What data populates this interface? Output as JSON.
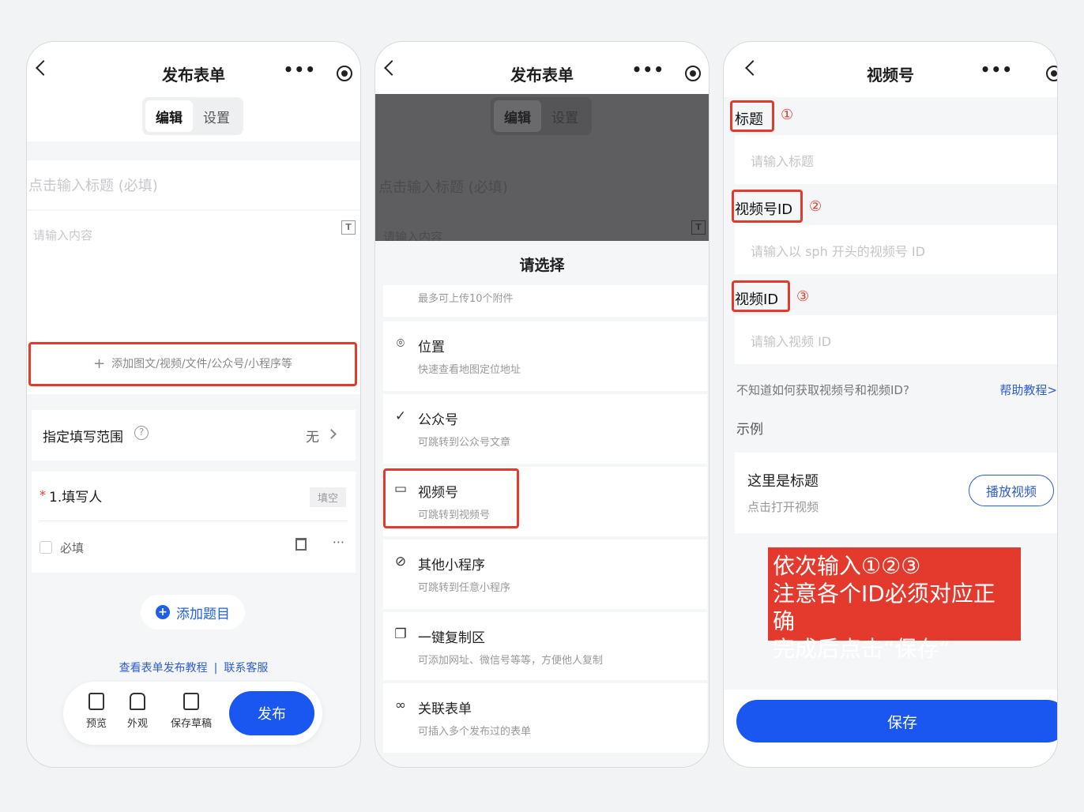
{
  "phone1": {
    "nav_title": "发布表单",
    "tabs": [
      "编辑",
      "设置"
    ],
    "title_placeholder": "点击输入标题 (必填)",
    "content_placeholder": "请输入内容",
    "t_icon": "T",
    "add_attachment": "添加图文/视频/文件/公众号/小程序等",
    "scope_label": "指定填写范围",
    "scope_value": "无",
    "question_label": "1.填写人",
    "required_star": "*",
    "question_tag": "填空",
    "required_label": "必填",
    "more_dots": "···",
    "add_question": "添加题目",
    "tutorial_link": "查看表单发布教程",
    "separator": "|",
    "support_link": "联系客服",
    "toolbar": {
      "preview": "预览",
      "appearance": "外观",
      "save_draft": "保存草稿",
      "publish": "发布"
    }
  },
  "phone2": {
    "nav_title": "发布表单",
    "tabs": [
      "编辑",
      "设置"
    ],
    "title_placeholder": "点击输入标题 (必填)",
    "content_placeholder": "请输入内容",
    "sheet_title": "请选择",
    "attachment_hint": "最多可上传10个附件",
    "options": [
      {
        "name": "位置",
        "desc": "快速查看地图定位地址",
        "icon": "location-icon"
      },
      {
        "name": "公众号",
        "desc": "可跳转到公众号文章",
        "icon": "official-account-icon"
      },
      {
        "name": "视频号",
        "desc": "可跳转到视频号",
        "icon": "video-icon"
      },
      {
        "name": "其他小程序",
        "desc": "可跳转到任意小程序",
        "icon": "mini-program-icon"
      },
      {
        "name": "一键复制区",
        "desc": "可添加网址、微信号等等，方便他人复制",
        "icon": "copy-icon"
      },
      {
        "name": "关联表单",
        "desc": "可插入多个发布过的表单",
        "icon": "link-icon"
      }
    ]
  },
  "phone3": {
    "nav_title": "视频号",
    "fields": [
      {
        "label": "标题",
        "num": "①",
        "placeholder": "请输入标题"
      },
      {
        "label": "视频号ID",
        "num": "②",
        "placeholder": "请输入以 sph 开头的视频号 ID"
      },
      {
        "label": "视频ID",
        "num": "③",
        "placeholder": "请输入视频 ID"
      }
    ],
    "help_question": "不知道如何获取视频号和视频ID?",
    "help_link": "帮助教程>",
    "example_label": "示例",
    "card_title": "这里是标题",
    "card_subtitle": "点击打开视频",
    "play_button": "播放视频",
    "note_lines": [
      "依次输入①②③",
      "注意各个ID必须对应正确",
      "完成后点击“保存”"
    ],
    "save_button": "保存"
  }
}
